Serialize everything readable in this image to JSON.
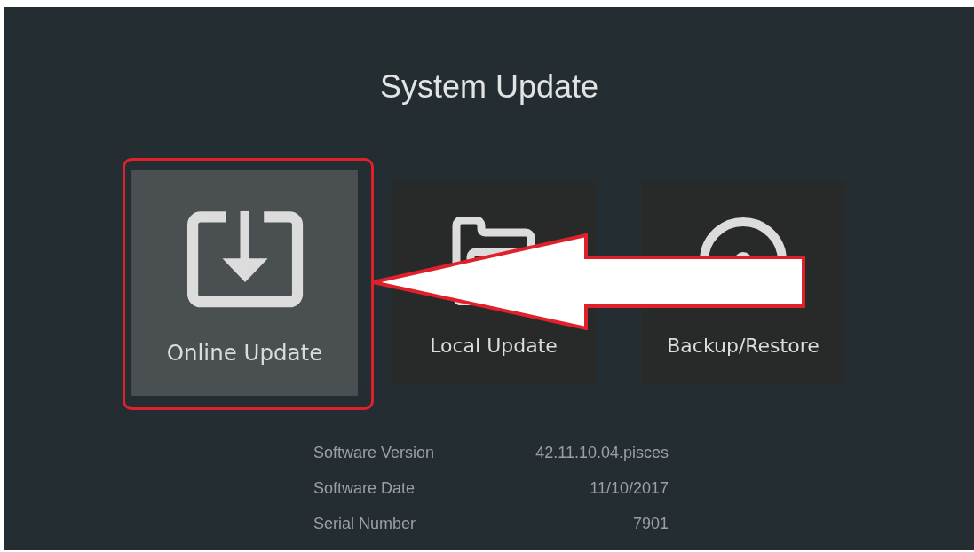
{
  "title": "System Update",
  "options": [
    {
      "kind": "online",
      "label": "Online Update",
      "selected": true
    },
    {
      "kind": "local",
      "label": "Local Update",
      "selected": false
    },
    {
      "kind": "backup",
      "label": "Backup/Restore",
      "selected": false
    }
  ],
  "info": [
    {
      "label": "Software Version",
      "value": "42.11.10.04.pisces"
    },
    {
      "label": "Software Date",
      "value": "11/10/2017"
    },
    {
      "label": "Serial Number",
      "value": "7901"
    }
  ]
}
